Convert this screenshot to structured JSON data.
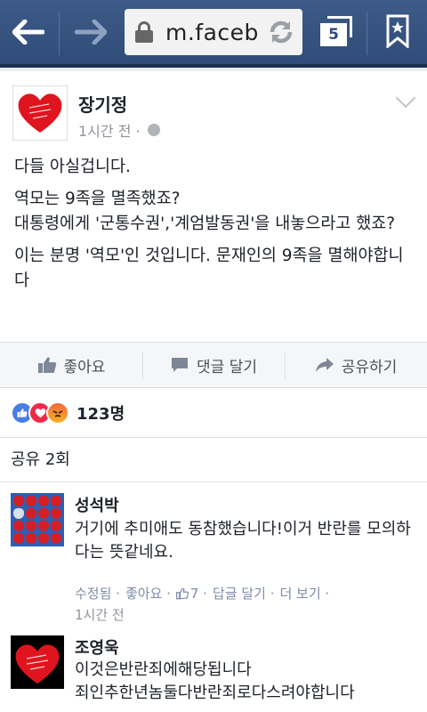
{
  "browser": {
    "url": "m.faceb",
    "tab_count": "5"
  },
  "post": {
    "author": "장기정",
    "time": "1시간 전 ·",
    "paragraphs": [
      "다들 아실겁니다.",
      "역모는 9족을 멸족했죠?\n대통령에게 '군통수권','계엄발동권'을 내놓으라고 했죠?",
      "이는 분명 '역모'인 것입니다. 문재인의 9족을 멸해야합니다"
    ]
  },
  "actions": {
    "like": "좋아요",
    "comment": "댓글 달기",
    "share": "공유하기"
  },
  "reactions": {
    "count": "123명"
  },
  "shares": {
    "label": "공유 2회"
  },
  "comments": [
    {
      "author": "성석박",
      "text": "거기에 추미애도 동참했습니다!이거 반란를 모의하다는 뜻같네요.",
      "actions": [
        "수정됨 ·",
        "좋아요 ·",
        "7 ·",
        "답글 달기 ·",
        "더 보기 ·"
      ],
      "time": "1시간 전"
    },
    {
      "author": "조영욱",
      "text": "이것은반란죄에해당됩니다\n죄인추한년놈둘다반란죄로다스려야합니다"
    }
  ],
  "colors": {
    "header": "#2f4b78",
    "link": "#7f8bab",
    "like_blue": "#4a7de2",
    "love_red": "#f0284a"
  }
}
